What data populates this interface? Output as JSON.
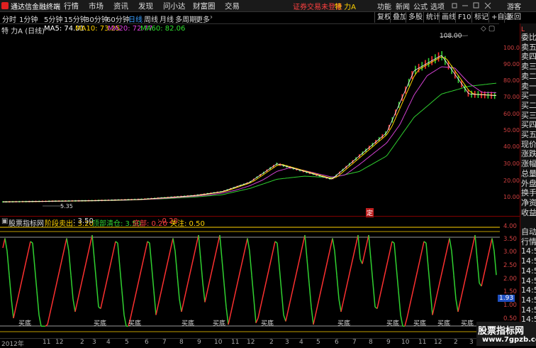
{
  "menu": {
    "app_name": "通达信金融终端",
    "items": [
      "行情",
      "市场",
      "资讯",
      "发现",
      "问小达",
      "财富圈",
      "交易"
    ],
    "alert": "证券交易未登录",
    "stock_label": "特 力A",
    "right_items": [
      "功能",
      "新闻",
      "公式",
      "选项",
      "游客"
    ]
  },
  "periods": [
    "分时",
    "1分钟",
    "5分钟",
    "15分钟",
    "30分钟",
    "60分钟",
    "日线",
    "周线",
    "月线",
    "多周期",
    "更多"
  ],
  "active_period": "日线",
  "toolbar": [
    "复权",
    "叠加",
    "多股",
    "统计",
    "画线",
    "F10",
    "标记",
    "+自选",
    "返回"
  ],
  "main_legend": {
    "title": "特 力A (日线)",
    "ma5": "MA5: 74.01",
    "ma10": "MA10: 73.25",
    "ma20": "MA20: 72.77",
    "ma60": "MA60: 82.06"
  },
  "price_annotations": {
    "high": "108.00",
    "low": "5.35",
    "marker": "定"
  },
  "sub_legend": {
    "title": "股票指标网",
    "stage_sell": "阶段卖出: 3.20",
    "stage_sell2": ": 3.50",
    "top_clear": "顶部清仓: 3.50",
    "bottom": "底部: 0.20",
    "bottom2": ": 0.20",
    "focus": "关注: 0.50"
  },
  "side_panel": [
    "委比",
    "卖五",
    "卖四",
    "卖三",
    "卖二",
    "卖一",
    "买一",
    "买二",
    "买三",
    "买四",
    "买五",
    "现价",
    "涨跌",
    "涨幅",
    "总量",
    "外盘",
    "换手",
    "净资",
    "收益",
    "",
    "自动",
    "行情",
    "14:55",
    "14:55",
    "14:55",
    "14:55",
    "14:55",
    "14:55",
    "14:55",
    "14:55"
  ],
  "side_top": "L",
  "y_ticks_main": [
    "100.0",
    "90.00",
    "80.00",
    "70.00",
    "60.00",
    "50.00",
    "40.00",
    "30.00",
    "20.00",
    "10.00"
  ],
  "y_ticks_sub": [
    "4.00",
    "3.50",
    "3.00",
    "2.50",
    "2.00",
    "1.50",
    "1.00",
    "0.50"
  ],
  "sub_current": "1.93",
  "x_ticks": [
    "2012年",
    "11",
    "12",
    "2",
    "3",
    "4",
    "5",
    "6",
    "7",
    "8",
    "9",
    "10",
    "11",
    "12",
    "2",
    "3",
    "4",
    "5",
    "6",
    "7",
    "8",
    "9",
    "10",
    "11",
    "12",
    "2",
    "3",
    "4"
  ],
  "signals": [
    "买底",
    "买底",
    "买底",
    "买底",
    "买底",
    "买底",
    "买底",
    "买底",
    "买底",
    "买底",
    "买底"
  ],
  "watermark": {
    "line1": "股票指标网",
    "line2": "www.7gpzb.com"
  },
  "colors": {
    "up": "#ff3030",
    "down": "#30d030",
    "ma5": "#ffffff",
    "ma10": "#ffd200",
    "ma20": "#e040e0",
    "ma60": "#30e030"
  },
  "chart_data": {
    "type": "line",
    "series": [
      {
        "name": "MA5",
        "values": [
          5.4,
          5.6,
          5.9,
          6.1,
          6.5,
          7.0,
          8.2,
          9.5,
          12,
          18,
          30,
          25,
          20,
          35,
          50,
          90,
          100,
          75,
          74
        ]
      },
      {
        "name": "MA60",
        "values": [
          5.5,
          5.6,
          5.8,
          6.0,
          6.3,
          6.8,
          7.5,
          8.5,
          10,
          14,
          20,
          22,
          21,
          25,
          35,
          60,
          75,
          80,
          82
        ]
      }
    ],
    "ylim": [
      0,
      110
    ]
  }
}
